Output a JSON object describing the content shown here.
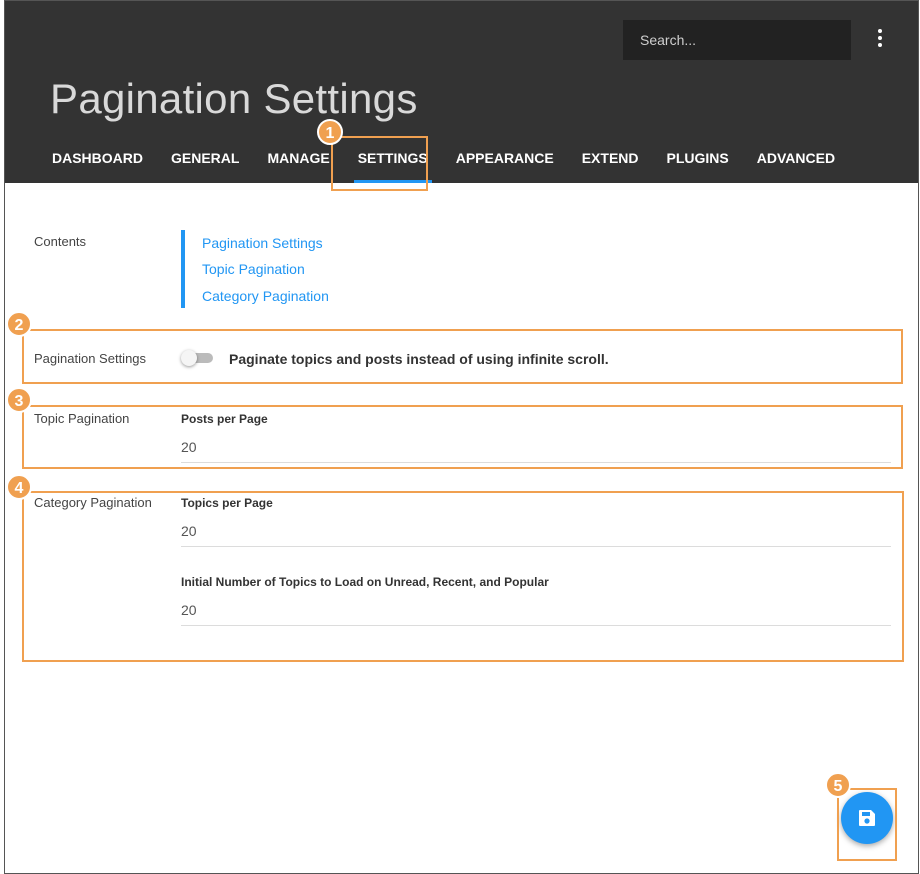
{
  "search": {
    "placeholder": "Search..."
  },
  "page": {
    "title": "Pagination Settings"
  },
  "nav": {
    "items": [
      {
        "label": "DASHBOARD"
      },
      {
        "label": "GENERAL"
      },
      {
        "label": "MANAGE"
      },
      {
        "label": "SETTINGS"
      },
      {
        "label": "APPEARANCE"
      },
      {
        "label": "EXTEND"
      },
      {
        "label": "PLUGINS"
      },
      {
        "label": "ADVANCED"
      }
    ],
    "active": "SETTINGS"
  },
  "contents": {
    "label": "Contents",
    "links": [
      "Pagination Settings",
      "Topic Pagination",
      "Category Pagination"
    ]
  },
  "sections": {
    "pagination": {
      "label": "Pagination Settings",
      "toggle_label": "Paginate topics and posts instead of using infinite scroll.",
      "toggle_on": false
    },
    "topic": {
      "label": "Topic Pagination",
      "posts_per_page_label": "Posts per Page",
      "posts_per_page_value": "20"
    },
    "category": {
      "label": "Category Pagination",
      "topics_per_page_label": "Topics per Page",
      "topics_per_page_value": "20",
      "initial_topics_label": "Initial Number of Topics to Load on Unread, Recent, and Popular",
      "initial_topics_value": "20"
    }
  },
  "annotations": [
    "1",
    "2",
    "3",
    "4",
    "5"
  ],
  "icons": {
    "menu": "kebab-menu-icon",
    "save": "save-icon"
  },
  "colors": {
    "accent": "#2196f3",
    "header_bg": "#333333",
    "annotation": "#f0a050"
  }
}
